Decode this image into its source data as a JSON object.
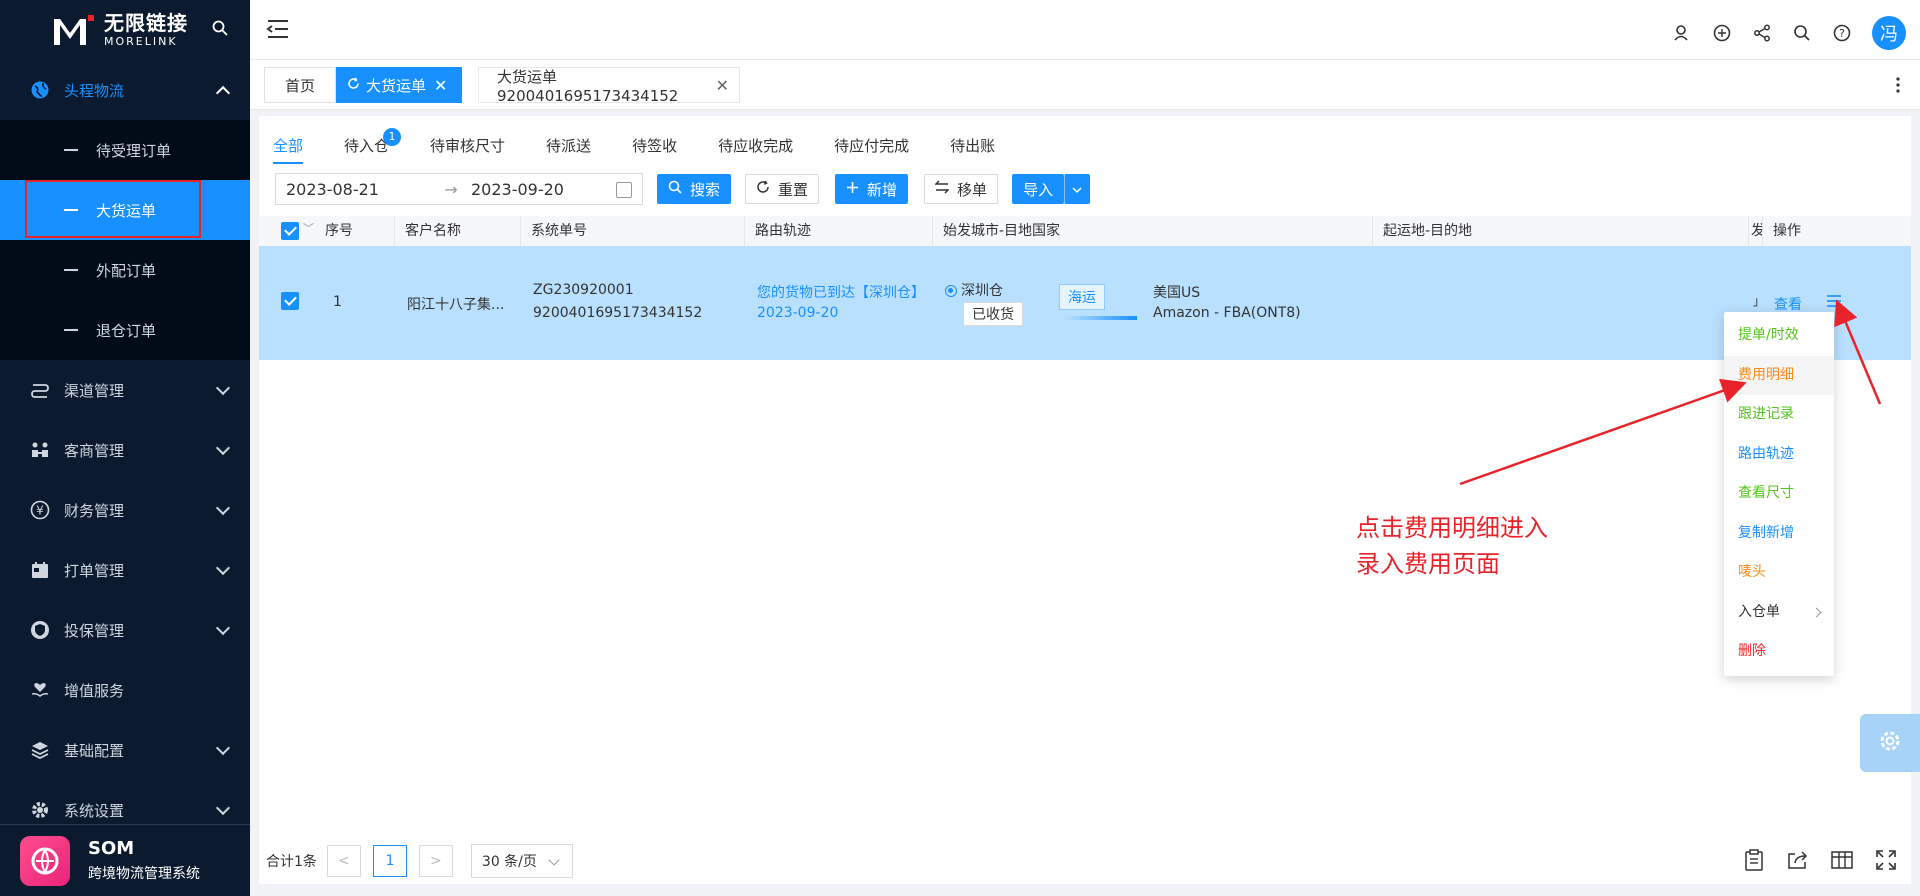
{
  "brand": {
    "name_cn": "无限链接",
    "name_en": "MORELINK"
  },
  "sidebar": {
    "groups": [
      {
        "label": "头程物流",
        "expanded": true
      },
      {
        "label": "渠道管理"
      },
      {
        "label": "客商管理"
      },
      {
        "label": "财务管理"
      },
      {
        "label": "打单管理"
      },
      {
        "label": "投保管理"
      },
      {
        "label": "增值服务"
      },
      {
        "label": "基础配置"
      },
      {
        "label": "系统设置"
      }
    ],
    "sub_items": [
      "待受理订单",
      "大货运单",
      "外配订单",
      "退仓订单"
    ],
    "active_sub": "大货运单",
    "footer": {
      "title": "SOM",
      "subtitle": "跨境物流管理系统"
    }
  },
  "topbar": {
    "avatar_text": "冯"
  },
  "tabs": [
    {
      "label": "首页"
    },
    {
      "label": "大货运单",
      "active": true
    },
    {
      "label": "大货运单9200401695173434152"
    }
  ],
  "status_tabs": {
    "items": [
      "全部",
      "待入仓",
      "待审核尺寸",
      "待派送",
      "待签收",
      "待应收完成",
      "待应付完成",
      "待出账"
    ],
    "badge": "1"
  },
  "filters": {
    "date_start": "2023-08-21",
    "date_arrow": "→",
    "date_end": "2023-09-20",
    "search_label": "搜索",
    "reset_label": "重置",
    "add_label": "新增",
    "move_label": "移单",
    "import_label": "导入"
  },
  "table": {
    "columns": [
      "序号",
      "客户名称",
      "系统单号",
      "路由轨迹",
      "始发城市-目地国家",
      "起运地-目的地",
      "发",
      "操作"
    ],
    "rows": [
      {
        "index": "1",
        "customer": "阳江十八子集...",
        "sys_no_1": "ZG230920001",
        "sys_no_2": "9200401695173434152",
        "route_text": "您的货物已到达【深圳仓】",
        "route_date": "2023-09-20",
        "origin": "深圳仓",
        "status_tag": "已收货",
        "transport": "海运",
        "dest_country": "美国US",
        "dest_detail": "Amazon - FBA(ONT8)",
        "partial": "」",
        "view_label": "查看"
      }
    ]
  },
  "dropdown": {
    "items": [
      {
        "label": "提单/时效",
        "color": "green"
      },
      {
        "label": "费用明细",
        "color": "orange",
        "hover": true
      },
      {
        "label": "跟进记录",
        "color": "green"
      },
      {
        "label": "路由轨迹",
        "color": "blue"
      },
      {
        "label": "查看尺寸",
        "color": "green"
      },
      {
        "label": "复制新增",
        "color": "blue"
      },
      {
        "label": "唛头",
        "color": "orange"
      },
      {
        "label": "入仓单",
        "color": "dark",
        "submenu": true
      },
      {
        "label": "删除",
        "color": "red"
      }
    ]
  },
  "annotation": {
    "line1": "点击费用明细进入",
    "line2": "录入费用页面"
  },
  "pagination": {
    "total": "合计1条",
    "prev": "<",
    "current": "1",
    "next": ">",
    "page_size": "30 条/页"
  },
  "colors": {
    "primary": "#1890ff",
    "sidebar_bg": "#0b1a2e",
    "annotation": "#e8242a",
    "row_selected": "#bae0ff"
  }
}
